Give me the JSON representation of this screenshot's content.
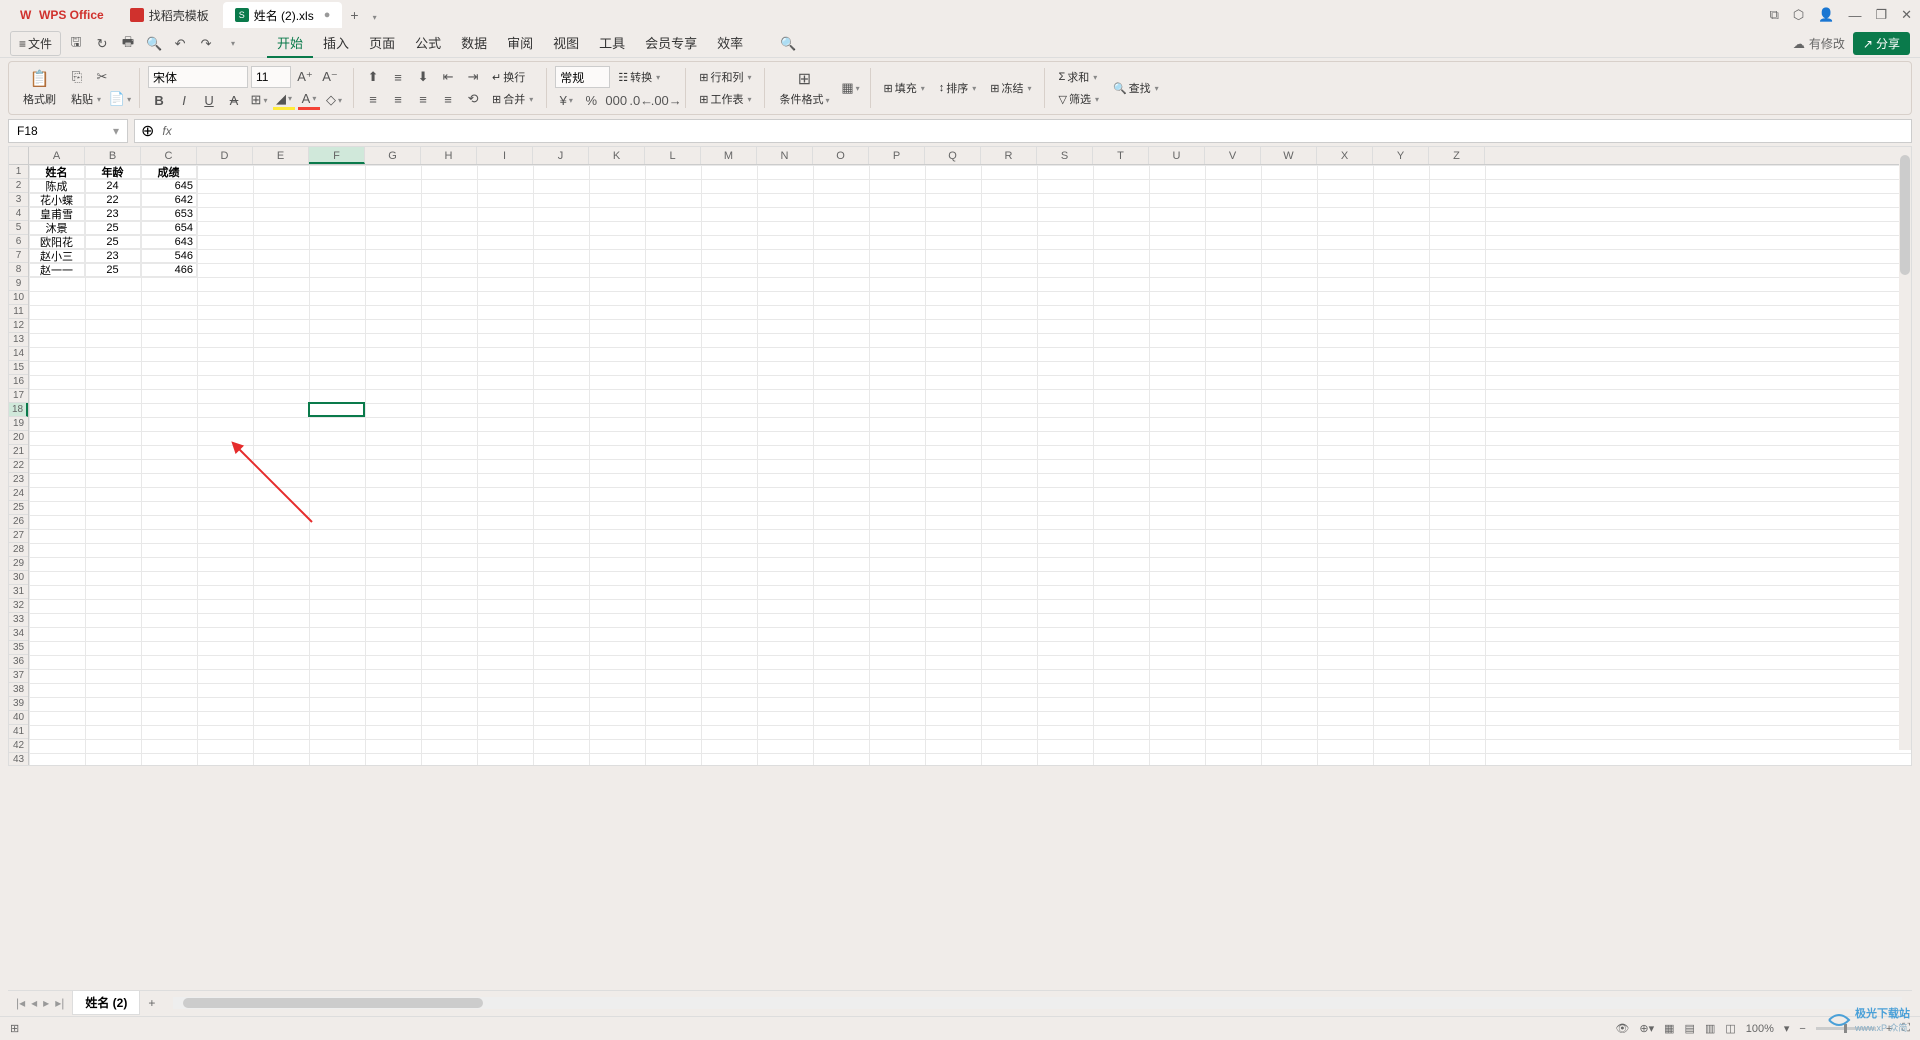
{
  "app": {
    "name": "WPS Office"
  },
  "tabs": {
    "template": "找稻壳模板",
    "file": "姓名 (2).xls"
  },
  "window": {
    "min": "—",
    "restore": "❐",
    "close": "✕",
    "cube": "⬚",
    "copy": "⧉"
  },
  "menu": {
    "file": "文件",
    "items": [
      "开始",
      "插入",
      "页面",
      "公式",
      "数据",
      "审阅",
      "视图",
      "工具",
      "会员专享",
      "效率"
    ],
    "active": "开始",
    "cloud": "有修改",
    "share": "分享"
  },
  "ribbon": {
    "format_painter": "格式刷",
    "paste": "粘贴",
    "cut": "✂",
    "font_name": "宋体",
    "font_size": "11",
    "wrap": "换行",
    "merge": "合并",
    "general": "常规",
    "convert": "转换",
    "rowcol": "行和列",
    "worksheet": "工作表",
    "cond_format": "条件格式",
    "fill": "填充",
    "sort": "排序",
    "freeze": "冻结",
    "sum": "求和",
    "filter": "筛选",
    "find": "查找"
  },
  "namebox": "F18",
  "columns": [
    "A",
    "B",
    "C",
    "D",
    "E",
    "F",
    "G",
    "H",
    "I",
    "J",
    "K",
    "L",
    "M",
    "N",
    "O",
    "P",
    "Q",
    "R",
    "S",
    "T",
    "U",
    "V",
    "W",
    "X",
    "Y",
    "Z"
  ],
  "rowcount": 43,
  "activeRow": 18,
  "activeCol": 5,
  "data": {
    "headers": [
      "姓名",
      "年龄",
      "成绩"
    ],
    "rows": [
      [
        "陈成",
        "24",
        "645"
      ],
      [
        "花小蝶",
        "22",
        "642"
      ],
      [
        "皇甫雪",
        "23",
        "653"
      ],
      [
        "沐景",
        "25",
        "654"
      ],
      [
        "欧阳花",
        "25",
        "643"
      ],
      [
        "赵小三",
        "23",
        "546"
      ],
      [
        "赵一一",
        "25",
        "466"
      ]
    ]
  },
  "sheet": {
    "name": "姓名 (2)"
  },
  "status": {
    "zoom": "100%"
  },
  "watermark": {
    "site": "极光下载站",
    "url": "www.xP 众简"
  }
}
